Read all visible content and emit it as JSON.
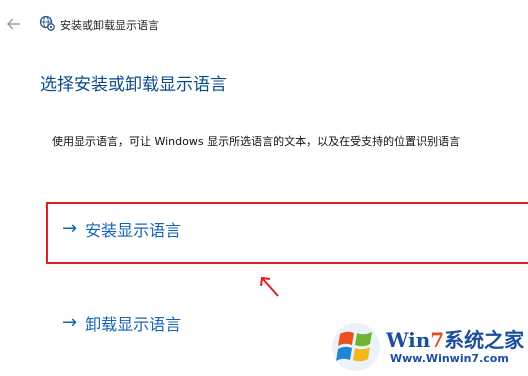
{
  "window": {
    "title": "安装或卸载显示语言",
    "back_icon": "arrow-left-icon",
    "app_icon": "language-gear-icon"
  },
  "page": {
    "heading": "选择安装或卸载显示语言",
    "description": "使用显示语言，可让 Windows 显示所选语言的文本，以及在受支持的位置识别语言"
  },
  "actions": {
    "arrow_glyph": "→",
    "install_label": "安装显示语言",
    "uninstall_label": "卸载显示语言"
  },
  "annotation": {
    "highlight_color": "#e01c25",
    "arrow_icon": "red-pointer-arrow-icon"
  },
  "watermark": {
    "title_prefix": "Win",
    "title_seven": "7",
    "title_suffix": "系统之家",
    "url": "Www.Winwin7.com",
    "logo_icon": "windows-7-logo-icon"
  },
  "colors": {
    "heading": "#0a4a8c",
    "link": "#1363b6",
    "highlight": "#e01c25",
    "watermark_blue": "#1b4f9c",
    "watermark_accent": "#e24a1f"
  }
}
